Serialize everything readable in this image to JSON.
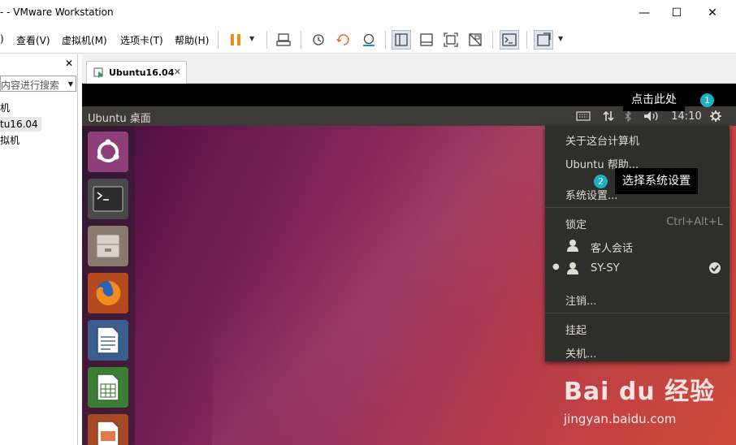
{
  "window": {
    "title": "- - VMware Workstation",
    "minimize": "—",
    "maximize": "☐",
    "close": "✕"
  },
  "menu": {
    "items": [
      "查看(V)",
      "虚拟机(M)",
      "选项卡(T)",
      "帮助(H)"
    ],
    "prefix": ")"
  },
  "library": {
    "close": "✕",
    "search_placeholder": "内容进行搜索",
    "items": [
      "机",
      "tu16.04",
      "拟机"
    ]
  },
  "tabs": [
    {
      "label": "Ubuntu16.04",
      "close": "✕"
    }
  ],
  "ubuntu": {
    "panel_title": "Ubuntu 桌面",
    "clock": "14:10",
    "menu": {
      "about": "关于这台计算机",
      "help": "Ubuntu 帮助...",
      "settings": "系统设置...",
      "lock": "锁定",
      "lock_shortcut": "Ctrl+Alt+L",
      "guest": "客人会话",
      "user": "SY-SY",
      "logout": "注销...",
      "suspend": "挂起",
      "shutdown": "关机..."
    }
  },
  "annotations": {
    "step1_num": "1",
    "step1_text": "点击此处",
    "step2_num": "2",
    "step2_text": "选择系统设置"
  },
  "watermark": {
    "logo": "Bai du 经验",
    "url": "jingyan.baidu.com"
  },
  "colors": {
    "accent_teal": "#1ab1c4",
    "unity_panel": "#3c3b37",
    "menu_bg": "#2e2e2b",
    "pause_orange": "#f58a1f"
  }
}
